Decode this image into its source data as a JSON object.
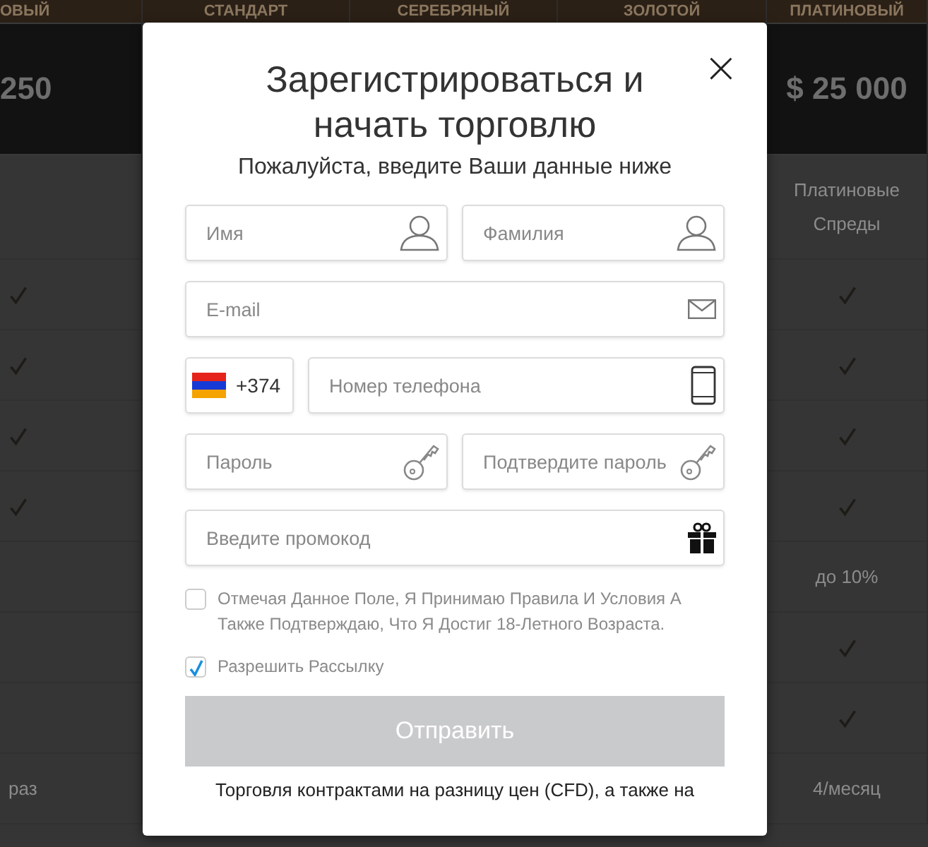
{
  "background_columns": [
    {
      "header": "ОВЫЙ",
      "price": "250",
      "cells": [
        {
          "kind": "empty"
        },
        {
          "kind": "check"
        },
        {
          "kind": "check"
        },
        {
          "kind": "check"
        },
        {
          "kind": "check"
        },
        {
          "kind": "empty"
        },
        {
          "kind": "empty"
        },
        {
          "kind": "empty"
        },
        {
          "kind": "text",
          "text": "раз"
        }
      ]
    },
    {
      "header": "СТАНДАРТ"
    },
    {
      "header": "СЕРЕБРЯНЫЙ"
    },
    {
      "header": "ЗОЛОТОЙ"
    },
    {
      "header": "ПЛАТИНОВЫЙ",
      "price": "$ 25 000",
      "cells": [
        {
          "kind": "text",
          "text": "Платиновые Спреды"
        },
        {
          "kind": "check"
        },
        {
          "kind": "check"
        },
        {
          "kind": "check"
        },
        {
          "kind": "check"
        },
        {
          "kind": "text",
          "text": "до 10%"
        },
        {
          "kind": "check"
        },
        {
          "kind": "check"
        },
        {
          "kind": "text",
          "text": "4/месяц"
        }
      ]
    }
  ],
  "dialog": {
    "close": "×",
    "title": "Зарегистрироваться и начать торговлю",
    "subtitle": "Пожалуйста, введите Ваши данные ниже",
    "field_rows": [
      [
        {
          "placeholder": "Имя",
          "kind": "person"
        },
        {
          "placeholder": "Фамилия",
          "kind": "person"
        }
      ],
      [
        {
          "placeholder": "E-mail",
          "kind": "mail"
        }
      ],
      [
        {
          "kind": "country",
          "code": "+374"
        },
        {
          "placeholder": "Номер телефона",
          "kind": "phone"
        }
      ],
      [
        {
          "placeholder": "Пароль",
          "kind": "key"
        },
        {
          "placeholder": "Подтвердите пароль",
          "kind": "key"
        }
      ],
      [
        {
          "placeholder": "Введите промокод",
          "kind": "gift"
        }
      ]
    ],
    "checkboxes": [
      {
        "label": "Отмечая Данное Поле, Я Принимаю Правила И Условия А Также Подтверждаю, Что Я Достиг 18-Летного Возраста.",
        "checked": false
      },
      {
        "label": "Разрешить Рассылку",
        "checked": true
      }
    ],
    "submit": {
      "label": "Отправить",
      "disabled": true
    },
    "disclaimer": "Торговля контрактами на разницу цен (CFD), а также на"
  }
}
